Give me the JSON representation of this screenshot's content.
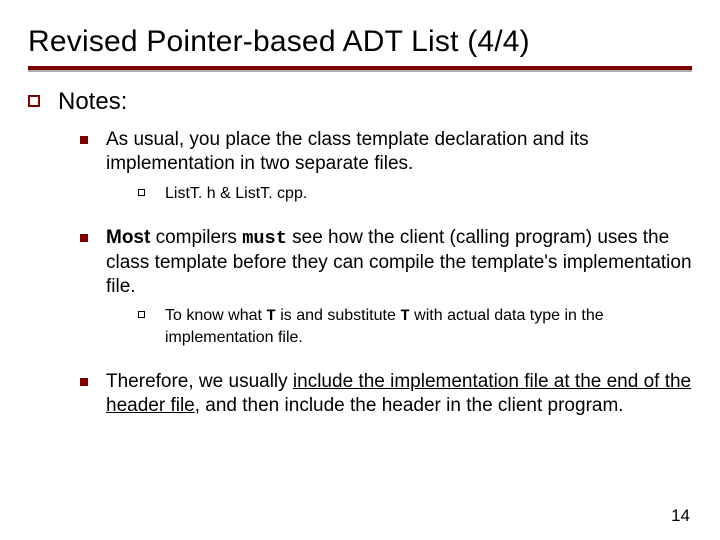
{
  "title": "Revised Pointer-based ADT List (4/4)",
  "notes_label": "Notes:",
  "bullets": {
    "b1": "As usual, you place the class template declaration and its implementation in two separate files.",
    "b1a": "ListT. h & ListT. cpp.",
    "b2_most": "Most",
    "b2_rest1": " compilers ",
    "b2_must": "must",
    "b2_rest2": " see how the client (calling program) uses the class template before they can compile the template's implementation file.",
    "b2a_pre": "To know what ",
    "b2a_T1": "T",
    "b2a_mid": " is and substitute ",
    "b2a_T2": "T",
    "b2a_post": " with actual data type in the implementation file.",
    "b3_pre": "Therefore, we usually ",
    "b3_ul": "include the implementation file at the end of the header file",
    "b3_post": ", and then include the header in the client program."
  },
  "page_number": "14"
}
